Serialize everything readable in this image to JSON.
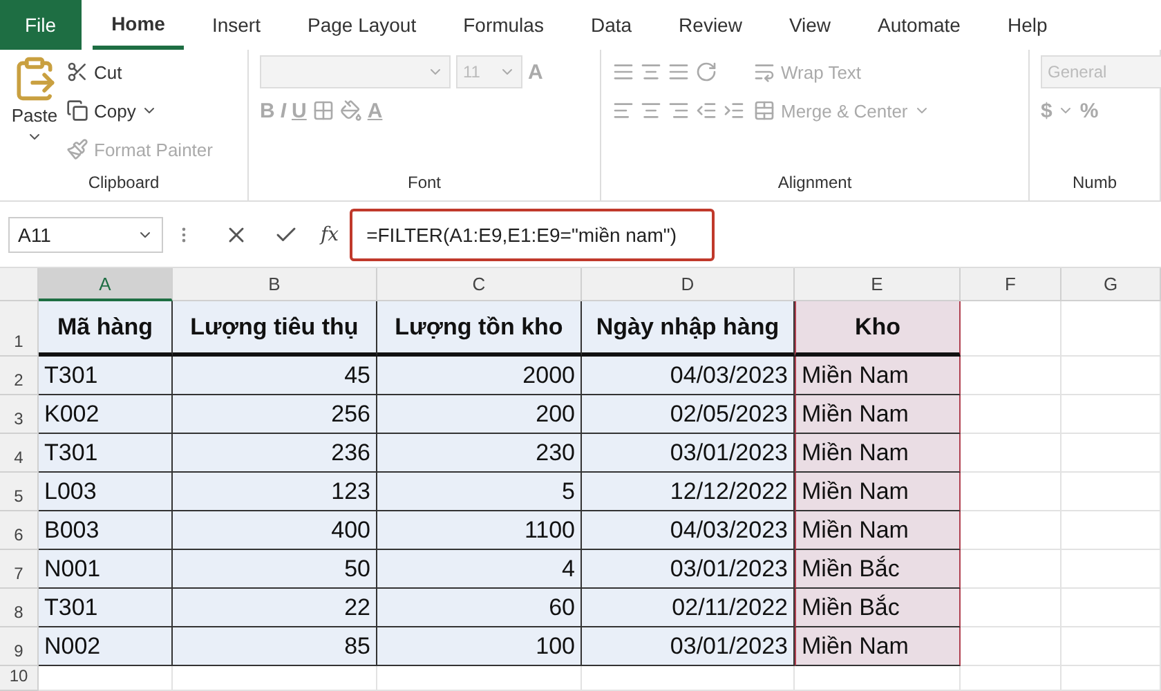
{
  "tabs": [
    {
      "label": "File",
      "kind": "file",
      "selected": false
    },
    {
      "label": "Home",
      "kind": "tab",
      "selected": true
    },
    {
      "label": "Insert",
      "kind": "tab",
      "selected": false
    },
    {
      "label": "Page Layout",
      "kind": "tab",
      "selected": false
    },
    {
      "label": "Formulas",
      "kind": "tab",
      "selected": false
    },
    {
      "label": "Data",
      "kind": "tab",
      "selected": false
    },
    {
      "label": "Review",
      "kind": "tab",
      "selected": false
    },
    {
      "label": "View",
      "kind": "tab",
      "selected": false
    },
    {
      "label": "Automate",
      "kind": "tab",
      "selected": false
    },
    {
      "label": "Help",
      "kind": "tab",
      "selected": false
    }
  ],
  "ribbon": {
    "clipboard": {
      "label": "Clipboard",
      "paste": "Paste",
      "cut": "Cut",
      "copy": "Copy",
      "format_painter": "Format Painter",
      "format_painter_disabled": true
    },
    "font": {
      "label": "Font",
      "size": "11",
      "grow": "A",
      "styles": [
        "B",
        "I",
        "U"
      ],
      "font_color": "A",
      "disabled": true
    },
    "alignment": {
      "label": "Alignment",
      "wrap_text": "Wrap Text",
      "merge_center": "Merge & Center",
      "disabled": true
    },
    "number": {
      "label": "Numb",
      "format": "General",
      "currency": "$",
      "percent": "%",
      "disabled": true
    }
  },
  "formula_bar": {
    "name_box": "A11",
    "function_label": "fx",
    "formula": "=FILTER(A1:E9,E1:E9=\"miền nam\")"
  },
  "columns": [
    {
      "label": "A",
      "selected": true
    },
    {
      "label": "B",
      "selected": false
    },
    {
      "label": "C",
      "selected": false
    },
    {
      "label": "D",
      "selected": false
    },
    {
      "label": "E",
      "selected": false
    },
    {
      "label": "F",
      "selected": false
    },
    {
      "label": "G",
      "selected": false
    }
  ],
  "rows": [
    {
      "number": "1",
      "cells": [
        "Mã hàng",
        "Lượng tiêu thụ",
        "Lượng tồn kho",
        "Ngày nhập hàng",
        "Kho"
      ]
    },
    {
      "number": "2",
      "cells": [
        "T301",
        "45",
        "2000",
        "04/03/2023",
        "Miền Nam"
      ]
    },
    {
      "number": "3",
      "cells": [
        "K002",
        "256",
        "200",
        "02/05/2023",
        "Miền Nam"
      ]
    },
    {
      "number": "4",
      "cells": [
        "T301",
        "236",
        "230",
        "03/01/2023",
        "Miền Nam"
      ]
    },
    {
      "number": "5",
      "cells": [
        "L003",
        "123",
        "5",
        "12/12/2022",
        "Miền Nam"
      ]
    },
    {
      "number": "6",
      "cells": [
        "B003",
        "400",
        "1100",
        "04/03/2023",
        "Miền Nam"
      ]
    },
    {
      "number": "7",
      "cells": [
        "N001",
        "50",
        "4",
        "03/01/2023",
        "Miền Bắc"
      ]
    },
    {
      "number": "8",
      "cells": [
        "T301",
        "22",
        "60",
        "02/11/2022",
        "Miền Bắc"
      ]
    },
    {
      "number": "9",
      "cells": [
        "N002",
        "85",
        "100",
        "03/01/2023",
        "Miền Nam"
      ]
    },
    {
      "number": "10",
      "cells": []
    }
  ]
}
